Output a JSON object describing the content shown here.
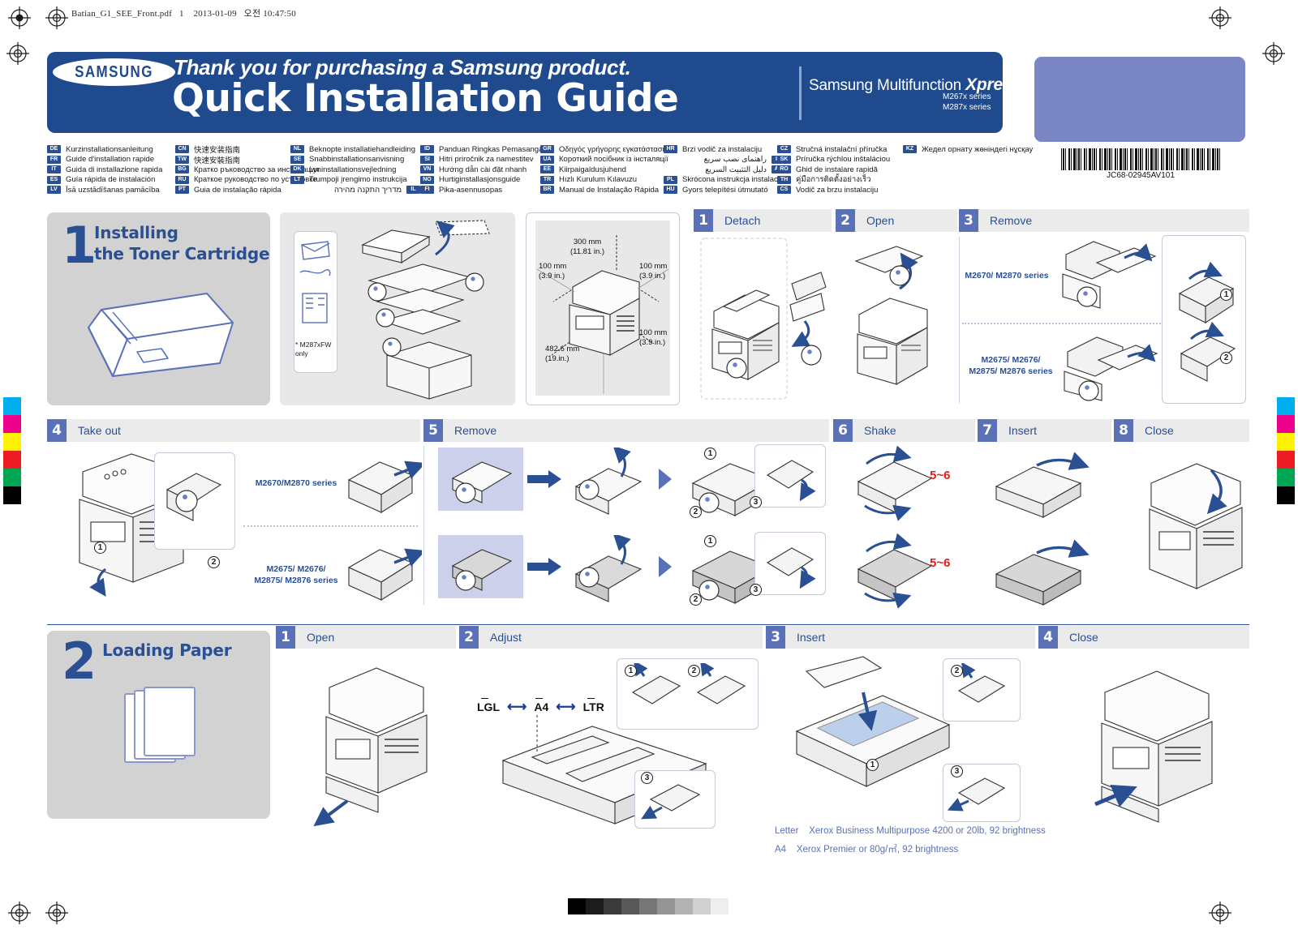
{
  "print_meta": {
    "filename": "Batian_G1_SEE_Front.pdf",
    "page": "1",
    "date": "2013-01-09",
    "time": "오전 10:47:50"
  },
  "header": {
    "brand": "SAMSUNG",
    "tagline": "Thank you for purchasing a Samsung product.",
    "title": "Quick Installation Guide",
    "product_line": "Samsung Multifunction ",
    "product_line_bold": "Xpress",
    "series_1": "M267x series",
    "series_2": "M287x series",
    "part_number": "JC68-02945AV101"
  },
  "languages": {
    "col1": [
      {
        "code": "DE",
        "text": "Kurzinstallationsanleitung"
      },
      {
        "code": "FR",
        "text": "Guide d'installation rapide"
      },
      {
        "code": "IT",
        "text": "Guida di installazione rapida"
      },
      {
        "code": "ES",
        "text": "Guía rápida de instalación"
      },
      {
        "code": "LV",
        "text": "Īsā uzstādīšanas pamācība"
      }
    ],
    "col2": [
      {
        "code": "CN",
        "text": "快速安装指南"
      },
      {
        "code": "TW",
        "text": "快速安裝指南"
      },
      {
        "code": "BG",
        "text": "Кратко ръководство за инсталация"
      },
      {
        "code": "RU",
        "text": "Краткое руководство по установке"
      },
      {
        "code": "PT",
        "text": "Guia de instalação rápida"
      }
    ],
    "col3": [
      {
        "code": "NL",
        "text": "Beknopte installatiehandleiding"
      },
      {
        "code": "SE",
        "text": "Snabbinstallationsanvisning"
      },
      {
        "code": "DK",
        "text": "Lyninstallationsvejledning"
      },
      {
        "code": "LT",
        "text": "Trumpoji įrengimo instrukcija"
      },
      {
        "code": "IL",
        "text": "מדריך התקנה מהירה",
        "rtl": true
      }
    ],
    "col4": [
      {
        "code": "ID",
        "text": "Panduan Ringkas Pemasangan"
      },
      {
        "code": "SI",
        "text": "Hitri priročnik za namestitev"
      },
      {
        "code": "VN",
        "text": "Hướng dẫn cài đặt nhanh"
      },
      {
        "code": "NO",
        "text": "Hurtiginstallasjonsguide"
      },
      {
        "code": "FI",
        "text": "Pika-asennusopas"
      }
    ],
    "col5": [
      {
        "code": "GR",
        "text": "Οδηγός γρήγορης εγκατάστασης"
      },
      {
        "code": "UA",
        "text": "Короткий посібник із інсталяції"
      },
      {
        "code": "EE",
        "text": "Kiirpaigaldusjuhend"
      },
      {
        "code": "TR",
        "text": "Hızlı Kurulum Kılavuzu"
      },
      {
        "code": "BR",
        "text": "Manual de Instalação Rápida"
      }
    ],
    "col6": [
      {
        "code": "HR",
        "text": "Brzi vodič za instalaciju"
      },
      {
        "code": "IR",
        "text": "راهنمای نصب سریع",
        "rtl": true
      },
      {
        "code": "AE",
        "text": "دليل التثبيت السريع",
        "rtl": true
      },
      {
        "code": "PL",
        "text": "Skrócona instrukcja instalacji"
      },
      {
        "code": "HU",
        "text": "Gyors telepítési útmutató"
      }
    ],
    "col7": [
      {
        "code": "CZ",
        "text": "Stručná instalační příručka"
      },
      {
        "code": "SK",
        "text": "Príručka rýchlou inštaláciou"
      },
      {
        "code": "RO",
        "text": "Ghid de instalare rapidă"
      },
      {
        "code": "TH",
        "text": "คู่มือการติดตั้งอย่างเร็ว"
      },
      {
        "code": "CS",
        "text": "Vodič za brzu instalaciju"
      }
    ],
    "col8": [
      {
        "code": "KZ",
        "text": "Жедел орнату жөніндегі нұсқау"
      }
    ]
  },
  "chapters": [
    {
      "number": "1",
      "title_line1": "Installing",
      "title_line2": "the Toner Cartridge"
    },
    {
      "number": "2",
      "title_line1": "Loading Paper",
      "title_line2": ""
    }
  ],
  "unpack_note": "* M287xFW\nonly",
  "clearance": {
    "top": "300 mm\n(11.81 in.)",
    "left": "100 mm\n(3.9 in.)",
    "right": "100 mm\n(3.9 in.)",
    "front_right": "100 mm\n(3.9 in.)",
    "depth": "482.6 mm\n(19.in.)"
  },
  "toner_steps": [
    {
      "num": "1",
      "label": "Detach"
    },
    {
      "num": "2",
      "label": "Open"
    },
    {
      "num": "3",
      "label": "Remove"
    },
    {
      "num": "4",
      "label": "Take out"
    },
    {
      "num": "5",
      "label": "Remove"
    },
    {
      "num": "6",
      "label": "Shake"
    },
    {
      "num": "7",
      "label": "Insert"
    },
    {
      "num": "8",
      "label": "Close"
    }
  ],
  "paper_steps": [
    {
      "num": "1",
      "label": "Open"
    },
    {
      "num": "2",
      "label": "Adjust"
    },
    {
      "num": "3",
      "label": "Insert"
    },
    {
      "num": "4",
      "label": "Close"
    }
  ],
  "model_labels": {
    "a": "M2670/ M2870 series",
    "b_line1": "M2675/ M2676/",
    "b_line2": "M2875/ M2876 series",
    "c": "M2670/M2870 series",
    "d_line1": "M2675/ M2676/",
    "d_line2": "M2875/ M2876 series"
  },
  "shake_count": "5~6",
  "paper_sizes": {
    "left": "LGL",
    "middle": "A4",
    "right": "LTR"
  },
  "paper_notes": [
    {
      "size": "Letter",
      "text": "Xerox Business Multipurpose 4200  or 20lb, 92 brightness"
    },
    {
      "size": "A4",
      "text": "Xerox Premier or 80g/㎡, 92 brightness"
    }
  ],
  "badges": {
    "one": "1",
    "two": "2",
    "three": "3"
  },
  "colors": {
    "samsung_blue": "#1f4b8e",
    "step_blue": "#5a71b8",
    "label_blue": "#2a4f93",
    "chapter_gray": "#d2d2d2",
    "stepbar_gray": "#ebebeb",
    "purple_block": "#7b86c4",
    "shake_red": "#e02020"
  },
  "calibration_swatches_left": [
    "#00aeef",
    "#ec008c",
    "#fff200",
    "#ed1c24",
    "#00a651",
    "#000000"
  ],
  "calibration_swatches_right": [
    "#00aeef",
    "#ec008c",
    "#fff200",
    "#ed1c24",
    "#00a651",
    "#000000"
  ],
  "grayscale_steps": [
    "#000000",
    "#1c1c1c",
    "#3a3a3a",
    "#585858",
    "#767676",
    "#949494",
    "#b2b2b2",
    "#d0d0d0",
    "#eeeeee"
  ]
}
